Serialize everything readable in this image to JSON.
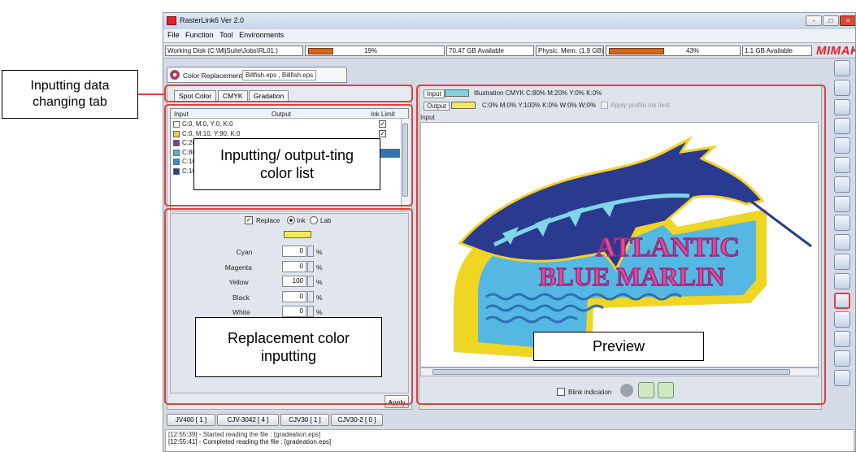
{
  "window": {
    "title": "RasterLink6 Ver 2.0",
    "controls": [
      "-",
      "□",
      "×"
    ]
  },
  "menu": [
    "File",
    "Function",
    "Tool",
    "Environments"
  ],
  "status": {
    "working_disk_label": "Working Disk (C:\\MljSuite\\Jobs\\RL01:)",
    "working_disk_percent_text": "19%",
    "working_disk_percent": 19,
    "working_disk_available": "70.47 GB Available",
    "phys_mem_label": "Physic. Mem. (1.9 GB)",
    "phys_mem_percent_text": "43%",
    "phys_mem_percent": 43,
    "phys_mem_available": "1.1 GB Available",
    "brand": "Mimaki",
    "brand_color": "#e4202a"
  },
  "function_tab": {
    "label": "Color Replacement",
    "files": "Billfish.eps , Billfish.eps"
  },
  "color_tabs": [
    "Spot Color",
    "CMYK",
    "Gradation"
  ],
  "color_list": {
    "headers": [
      "Input",
      "Output",
      "Ink Limit"
    ],
    "rows": [
      {
        "swatch": "#ffffff",
        "text": "C:0, M:0, Y:0, K:0",
        "checked": true
      },
      {
        "swatch": "#f2d22e",
        "text": "C:0, M:10, Y:90, K:0",
        "checked": true
      },
      {
        "swatch": "#7b3fa0",
        "text": "C:20,",
        "checked": false
      },
      {
        "swatch": "#4fb6d8",
        "text": "C:80,",
        "checked": false
      },
      {
        "swatch": "#3a8fd0",
        "text": "C:100",
        "checked": false
      },
      {
        "swatch": "#2a3d8f",
        "text": "C:100",
        "checked": false
      }
    ]
  },
  "replacement": {
    "replace_label": "Replace",
    "ink_label": "Ink",
    "lab_label": "Lab",
    "swatch": "#f2e85a",
    "fields": [
      {
        "label": "Cyan",
        "value": "0",
        "unit": "%"
      },
      {
        "label": "Magenta",
        "value": "0",
        "unit": "%"
      },
      {
        "label": "Yellow",
        "value": "100",
        "unit": "%"
      },
      {
        "label": "Black",
        "value": "0",
        "unit": "%"
      },
      {
        "label": "White",
        "value": "0",
        "unit": "%"
      }
    ],
    "apply_label": "Apply"
  },
  "preview_header": {
    "input_label": "Input",
    "input_desc": "Illustration  CMYK  C:80% M:20% Y:0% K:0%",
    "input_color": "#7dd3e0",
    "output_label": "Output",
    "output_desc": "C:0% M:0% Y:100% K:0% W:0% W:0%",
    "output_color": "#f2e85a",
    "apply_profile_label": "Apply profile ink limit",
    "canvas_label": "Input"
  },
  "preview_image": {
    "line1": "ATLANTIC",
    "line2": "BLUE MARLIN"
  },
  "preview_footer": {
    "blink_label": "Blink indication"
  },
  "job_tabs": [
    "JV400 [ 1 ]",
    "CJV-3042 [ 4 ]",
    "CJV30 [ 1 ]",
    "CJV30-2 [ 0 ]"
  ],
  "log": [
    "[12:55:39] - Started reading the file : [gradeation.eps]",
    "[12:55:41] - Completed reading the file : [gradeation.eps]"
  ],
  "callouts": {
    "tab": "Inputting data changing tab",
    "list": "Inputting/ output-ting color list",
    "replacement": "Replacement color inputting",
    "preview": "Preview"
  },
  "colors": {
    "highlight": "#e0413a"
  }
}
